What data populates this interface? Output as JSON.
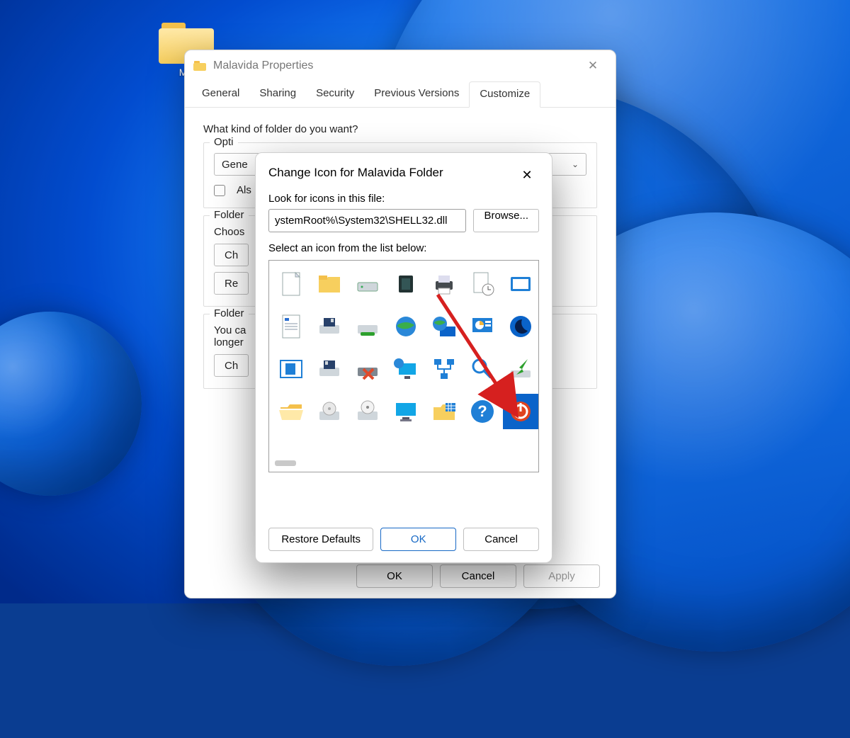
{
  "desktop": {
    "icon_label": "Ma"
  },
  "properties_window": {
    "title": "Malavida Properties",
    "tabs": [
      "General",
      "Sharing",
      "Security",
      "Previous Versions",
      "Customize"
    ],
    "heading": "What kind of folder do you want?",
    "optimize_legend": "Opti",
    "combo_value": "Gene",
    "also_label": "Als",
    "folder_pic_legend": "Folder",
    "choose_label": "Choos",
    "choose_btn": "Ch",
    "restore_btn": "Re",
    "folder_icons_legend": "Folder",
    "you_can_line1": "You ca",
    "you_can_line2": "longer",
    "change_btn": "Ch",
    "ok": "OK",
    "cancel": "Cancel",
    "apply": "Apply"
  },
  "change_icon_dialog": {
    "title": "Change Icon for Malavida Folder",
    "look_label": "Look for icons in this file:",
    "path_value": "ystemRoot%\\System32\\SHELL32.dll",
    "browse": "Browse...",
    "select_label": "Select an icon from the list below:",
    "restore_defaults": "Restore Defaults",
    "ok": "OK",
    "cancel": "Cancel",
    "icons": [
      "blank-document",
      "folder",
      "hard-drive",
      "chip",
      "printer",
      "document-clock",
      "run-window",
      "text-document",
      "floppy-drive",
      "removable-drive",
      "globe",
      "globe-monitor",
      "chart-presentation",
      "night-monitor",
      "window-panel",
      "floppy-drive-2",
      "drive-error",
      "network-monitor",
      "network-nodes",
      "magnifier",
      "drive-arrow",
      "folder-open",
      "dvd-drive",
      "cd-drive",
      "monitor",
      "folder-grid",
      "help-circle",
      "power-button"
    ],
    "selected_index": 27
  }
}
